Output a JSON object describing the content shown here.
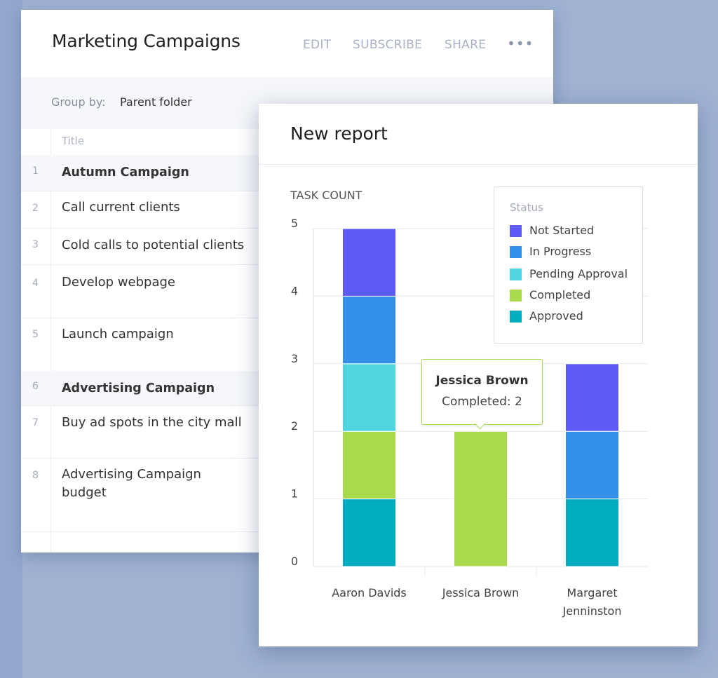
{
  "list": {
    "title": "Marketing Campaigns",
    "actions": {
      "edit": "EDIT",
      "subscribe": "SUBSCRIBE",
      "share": "SHARE",
      "more": "•••"
    },
    "group_by": {
      "label": "Group by:",
      "value": "Parent folder"
    },
    "column_title": "Title",
    "rows": [
      {
        "num": "1",
        "text": "Autumn Campaign",
        "group": true
      },
      {
        "num": "2",
        "text": "Call current clients",
        "group": false
      },
      {
        "num": "3",
        "text": "Cold calls to potential clients",
        "group": false
      },
      {
        "num": "4",
        "text": "Develop webpage",
        "group": false
      },
      {
        "num": "5",
        "text": "Launch campaign",
        "group": false
      },
      {
        "num": "6",
        "text": "Advertising Campaign",
        "group": true
      },
      {
        "num": "7",
        "text": "Buy ad spots in the city mall",
        "group": false
      },
      {
        "num": "8",
        "text": "Advertising Campaign budget",
        "group": false
      }
    ]
  },
  "report": {
    "title": "New report",
    "legend": {
      "title": "Status",
      "items": [
        {
          "label": "Not Started",
          "color": "#5e5bf5"
        },
        {
          "label": "In Progress",
          "color": "#338fe8"
        },
        {
          "label": "Pending Approval",
          "color": "#4fd4e0"
        },
        {
          "label": "Completed",
          "color": "#a9d94c"
        },
        {
          "label": "Approved",
          "color": "#00acbe"
        }
      ]
    },
    "tooltip": {
      "name": "Jessica Brown",
      "series": "Completed",
      "value": "2"
    }
  },
  "chart_data": {
    "type": "bar",
    "stacked": true,
    "ylabel": "TASK COUNT",
    "ylim": [
      0,
      5
    ],
    "yticks": [
      0,
      1,
      2,
      3,
      4,
      5
    ],
    "categories": [
      "Aaron Davids",
      "Jessica Brown",
      "Margaret Jenninston"
    ],
    "series": [
      {
        "name": "Approved",
        "color": "#00acbe",
        "values": [
          1,
          0,
          1
        ]
      },
      {
        "name": "Completed",
        "color": "#a9d94c",
        "values": [
          1,
          2,
          0
        ]
      },
      {
        "name": "Pending Approval",
        "color": "#4fd4e0",
        "values": [
          1,
          0,
          0
        ]
      },
      {
        "name": "In Progress",
        "color": "#338fe8",
        "values": [
          1,
          0,
          1
        ]
      },
      {
        "name": "Not Started",
        "color": "#5e5bf5",
        "values": [
          1,
          0,
          1
        ]
      }
    ],
    "legend_position": "top-right",
    "grid": true
  }
}
